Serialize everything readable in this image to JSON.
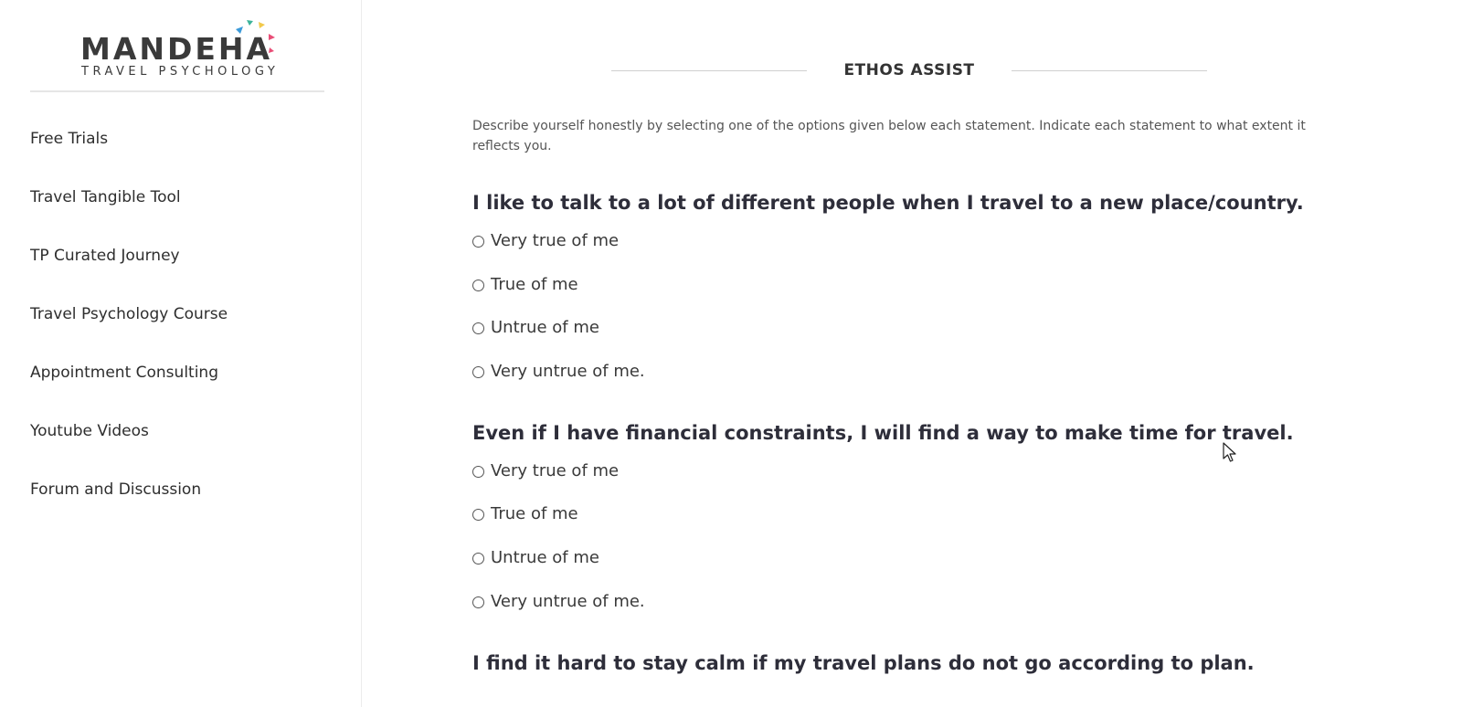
{
  "brand": {
    "name": "MANDEHA",
    "tagline": "TRAVEL PSYCHOLOGY",
    "mark_colors": [
      "#3b9ad9",
      "#3bb39a",
      "#f2c94c",
      "#e94e77"
    ]
  },
  "sidebar": {
    "items": [
      {
        "label": "Free Trials"
      },
      {
        "label": "Travel Tangible Tool"
      },
      {
        "label": "TP Curated Journey"
      },
      {
        "label": "Travel Psychology Course"
      },
      {
        "label": "Appointment Consulting"
      },
      {
        "label": "Youtube Videos"
      },
      {
        "label": "Forum and Discussion"
      }
    ]
  },
  "main": {
    "title": "ETHOS ASSIST",
    "instructions": "Describe yourself honestly by selecting one of the options given below each statement. Indicate each statement to what extent it reflects you.",
    "questions": [
      {
        "text": "I like to talk to a lot of different people when I travel to a new place/country.",
        "options": [
          "Very true of me",
          "True of me",
          "Untrue of me",
          "Very untrue of me."
        ],
        "selected": null
      },
      {
        "text": "Even if I have financial constraints, I will find a way to make time for travel.",
        "options": [
          "Very true of me",
          "True of me",
          "Untrue of me",
          "Very untrue of me."
        ],
        "selected": null
      },
      {
        "text": "I find it hard to stay calm if my travel plans do not go according to plan."
      }
    ]
  },
  "colors": {
    "text_primary": "#2e2e3a",
    "sidebar_border": "#ececec",
    "divider": "#cfcfcf"
  }
}
